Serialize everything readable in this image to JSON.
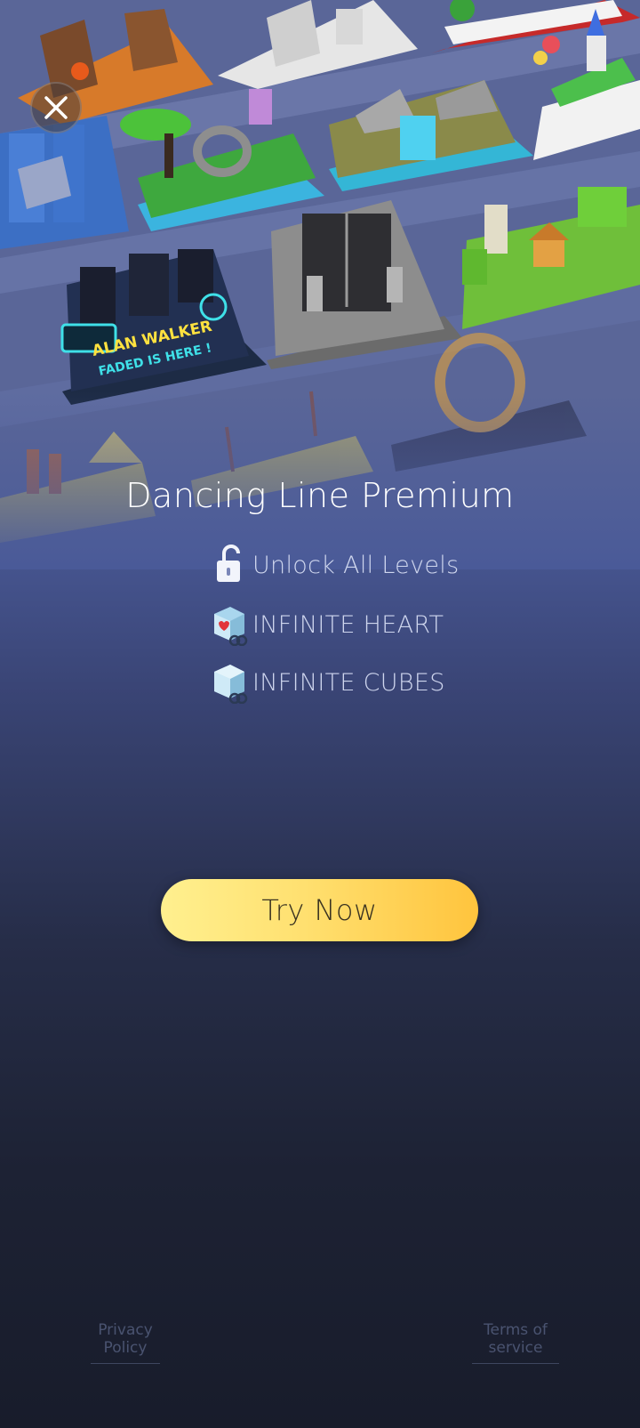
{
  "background_art": {
    "level_sign_line1": "ALAN WALKER",
    "level_sign_line2": "FADED IS HERE !"
  },
  "close_button": {
    "icon": "close-icon"
  },
  "premium": {
    "title": "Dancing Line Premium",
    "features": [
      {
        "icon": "unlock-icon",
        "label": "Unlock All Levels"
      },
      {
        "icon": "heart-cube-icon",
        "label": "INFINITE HEART"
      },
      {
        "icon": "cube-icon",
        "label": "INFINITE CUBES"
      }
    ],
    "cta_label": "Try Now"
  },
  "footer": {
    "privacy_label": "Privacy Policy",
    "terms_label": "Terms of service"
  },
  "colors": {
    "cta_start": "#fff08f",
    "cta_end": "#ffc43d",
    "background_top": "#4a5a98",
    "background_bottom": "#181c2b"
  }
}
